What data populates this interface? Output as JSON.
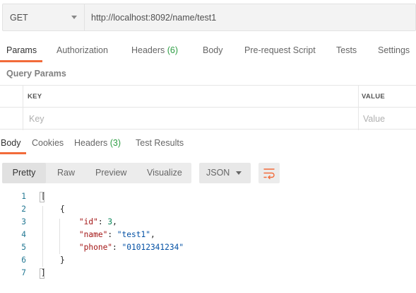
{
  "request": {
    "method": "GET",
    "url": "http://localhost:8092/name/test1"
  },
  "request_tabs": [
    {
      "label": "Params",
      "badge": ""
    },
    {
      "label": "Authorization",
      "badge": ""
    },
    {
      "label": "Headers",
      "badge": "(6)"
    },
    {
      "label": "Body",
      "badge": ""
    },
    {
      "label": "Pre-request Script",
      "badge": ""
    },
    {
      "label": "Tests",
      "badge": ""
    },
    {
      "label": "Settings",
      "badge": ""
    }
  ],
  "query_params": {
    "title": "Query Params",
    "col_key": "KEY",
    "col_value": "VALUE",
    "key_placeholder": "Key",
    "value_placeholder": "Value"
  },
  "response_tabs": [
    {
      "label": "Body",
      "badge": ""
    },
    {
      "label": "Cookies",
      "badge": ""
    },
    {
      "label": "Headers",
      "badge": "(3)"
    },
    {
      "label": "Test Results",
      "badge": ""
    }
  ],
  "view_modes": [
    "Pretty",
    "Raw",
    "Preview",
    "Visualize"
  ],
  "format": "JSON",
  "code_lines": [
    {
      "n": "1",
      "parts": [
        [
          "p",
          "["
        ]
      ]
    },
    {
      "n": "2",
      "parts": [
        [
          "p",
          "    {"
        ]
      ]
    },
    {
      "n": "3",
      "parts": [
        [
          "p",
          "        "
        ],
        [
          "k",
          "\"id\""
        ],
        [
          "p",
          ": "
        ],
        [
          "n",
          "3"
        ],
        [
          "p",
          ","
        ]
      ]
    },
    {
      "n": "4",
      "parts": [
        [
          "p",
          "        "
        ],
        [
          "k",
          "\"name\""
        ],
        [
          "p",
          ": "
        ],
        [
          "s",
          "\"test1\""
        ],
        [
          "p",
          ","
        ]
      ]
    },
    {
      "n": "5",
      "parts": [
        [
          "p",
          "        "
        ],
        [
          "k",
          "\"phone\""
        ],
        [
          "p",
          ": "
        ],
        [
          "s",
          "\"01012341234\""
        ]
      ]
    },
    {
      "n": "6",
      "parts": [
        [
          "p",
          "    }"
        ]
      ]
    },
    {
      "n": "7",
      "parts": [
        [
          "p",
          "]"
        ]
      ]
    }
  ],
  "colors": {
    "accent": "#f26b3a",
    "badge_green": "#2e9e44",
    "json_key": "#a31515",
    "json_number": "#098658",
    "json_string": "#0451a5",
    "line_number": "#237893"
  }
}
